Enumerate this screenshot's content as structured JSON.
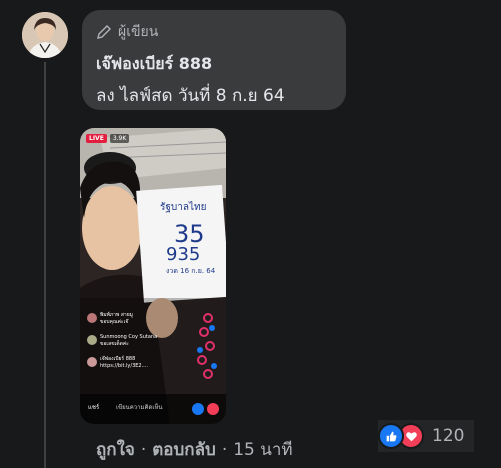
{
  "comment": {
    "author_badge": "ผู้เขียน",
    "author_name": "เจ๊ฟองเบียร์ 888",
    "text": "ลง ไลฟ์สด วันที่ 8 ก.ย 64"
  },
  "attachment": {
    "live_label": "LIVE",
    "viewers": "3.9K",
    "paper_title": "รัฐบาลไทย",
    "paper_number_1": "35",
    "paper_number_2": "935",
    "paper_note": "งวด 16 ก.ย. 64",
    "live_comments": [
      {
        "name": "พิมพ์ภาพ สายมู",
        "text": "ขอบคุณค่ะเจ๊"
      },
      {
        "name": "Sunmoong Coy Sutana",
        "text": "ขอเลขเด็ดค่ะ"
      },
      {
        "name": "เจ๊ฟองเบียร์ 888",
        "text": "https://bit.ly/3E2...."
      }
    ],
    "share_label": "แชร์",
    "write_comment_placeholder": "เขียนความคิดเห็น"
  },
  "actions": {
    "like": "ถูกใจ",
    "separator": "·",
    "reply": "ตอบกลับ",
    "time": "15 นาที"
  },
  "reactions": {
    "count": "120",
    "types": [
      "like-icon",
      "love-icon"
    ],
    "like_color": "#1877f2",
    "love_color": "#f33e58"
  }
}
